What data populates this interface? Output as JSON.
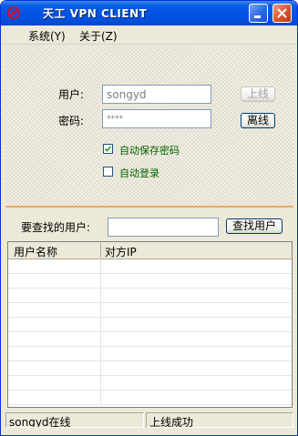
{
  "window": {
    "title": "天工 VPN CLIENT",
    "icon": "app-logo-icon"
  },
  "menu": {
    "items": [
      {
        "label": "系统(Y)"
      },
      {
        "label": "关于(Z)"
      }
    ]
  },
  "login": {
    "username_label": "用户:",
    "username_value": "songyd",
    "password_label": "密码:",
    "password_value": "****",
    "online_button": "上线",
    "offline_button": "离线",
    "save_password_label": "自动保存密码",
    "save_password_checked": true,
    "auto_login_label": "自动登录",
    "auto_login_checked": false
  },
  "search": {
    "label": "要查找的用户:",
    "value": "",
    "button": "查找用户"
  },
  "table": {
    "columns": [
      "用户名称",
      "对方IP"
    ],
    "rows": []
  },
  "status": {
    "left": "songyd在线",
    "right": "上线成功"
  }
}
